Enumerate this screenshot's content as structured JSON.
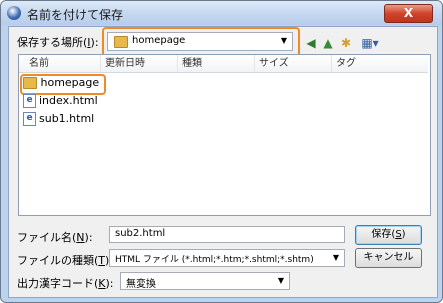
{
  "window": {
    "title": "名前を付けて保存",
    "close_label": "X"
  },
  "location": {
    "label": "保存する場所(",
    "label_key": "I",
    "label_end": "):",
    "value": "homepage"
  },
  "columns": [
    "名前",
    "更新日時",
    "種類",
    "サイズ",
    "タグ"
  ],
  "files": [
    {
      "name": "homepage",
      "icon": "folder-icon"
    },
    {
      "name": "index.html",
      "icon": "ie-html-icon"
    },
    {
      "name": "sub1.html",
      "icon": "ie-html-icon"
    }
  ],
  "filename": {
    "label": "ファイル名(",
    "label_key": "N",
    "label_end": "):",
    "value": "sub2.html"
  },
  "filetype": {
    "label": "ファイルの種類(",
    "label_key": "T",
    "label_end": "):",
    "value": "HTML ファイル (*.html;*.htm;*.shtml;*.shtm)"
  },
  "encoding": {
    "label": "出力漢字コード(",
    "label_key": "K",
    "label_end": "):",
    "value": "無変換"
  },
  "buttons": {
    "save": "保存(",
    "save_key": "S",
    "save_end": ")",
    "cancel": "キャンセル"
  },
  "colors": {
    "highlight": "#f08a24",
    "titlebar": "#c6d9f1",
    "close": "#d0442c"
  }
}
